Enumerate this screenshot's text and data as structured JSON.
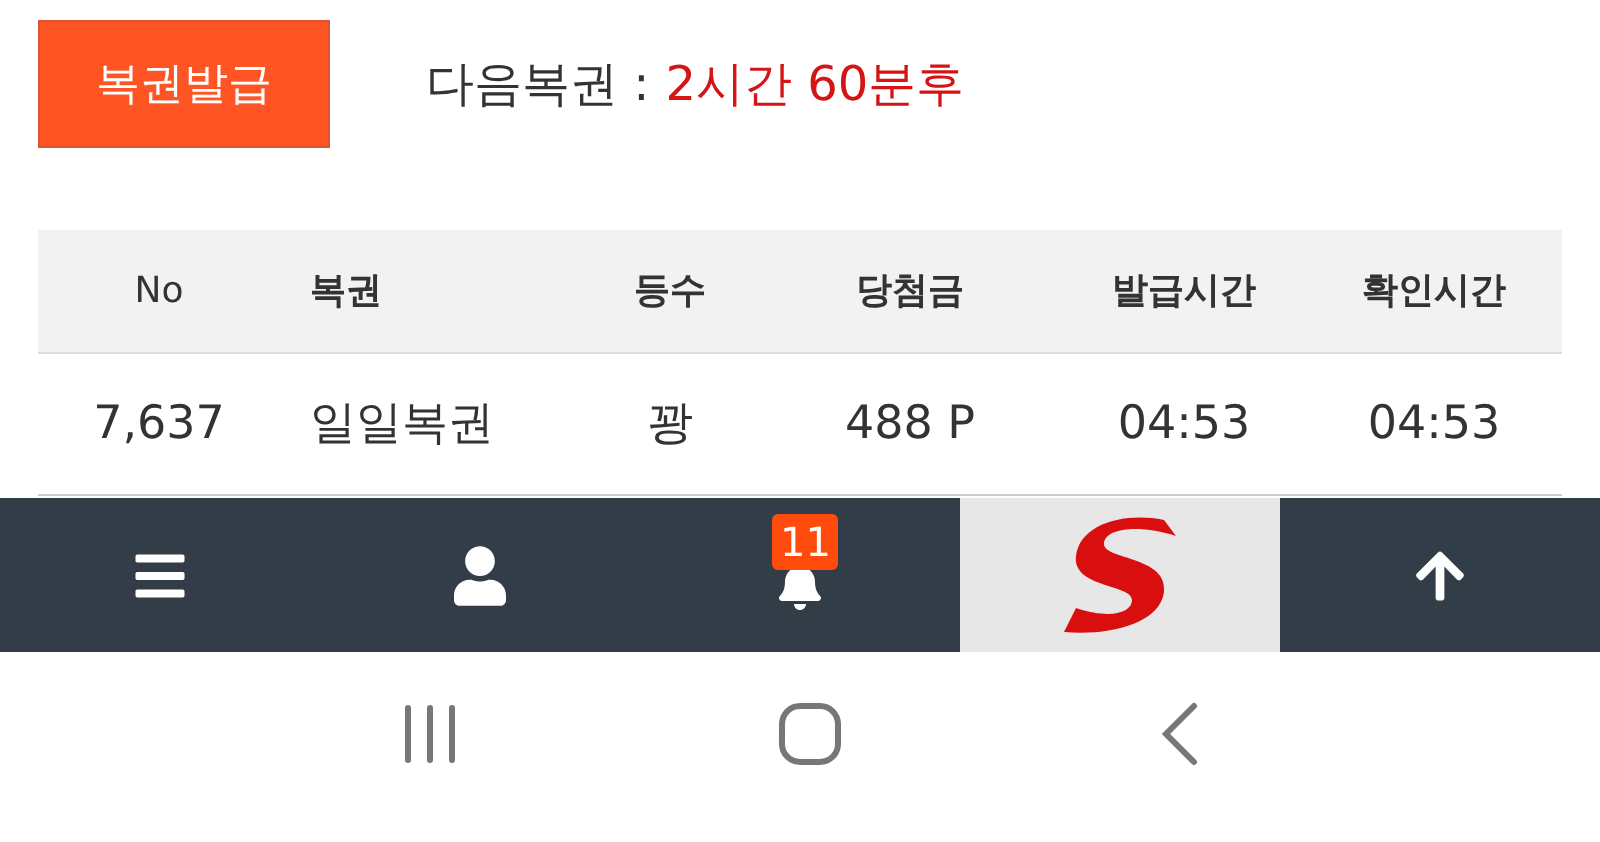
{
  "issue_button": "복권발급",
  "next_lottery": {
    "label": "다음복권 :",
    "value": "2시간 60분후"
  },
  "table": {
    "columns": [
      "No",
      "복권",
      "등수",
      "당첨금",
      "발급시간",
      "확인시간"
    ],
    "rows": [
      [
        "7,637",
        "일일복권",
        "꽝",
        "488 P",
        "04:53",
        "04:53"
      ]
    ]
  },
  "bottom_nav": [
    {
      "kind": "menu",
      "selected": false
    },
    {
      "kind": "user",
      "selected": false
    },
    {
      "kind": "bell",
      "badge": "11",
      "selected": false
    },
    {
      "kind": "logo",
      "selected": true
    },
    {
      "kind": "top",
      "selected": false
    }
  ]
}
